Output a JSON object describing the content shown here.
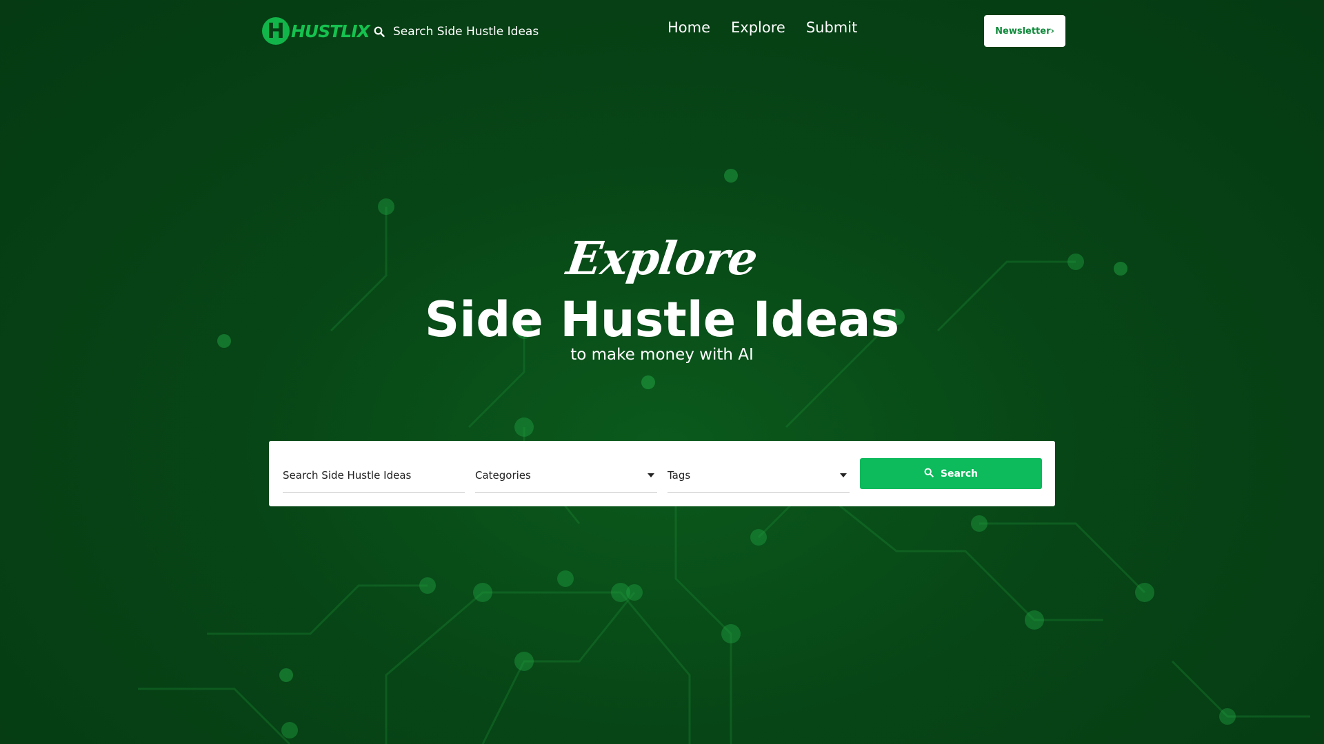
{
  "header": {
    "logo_mark": "H",
    "logo_text": "HUSTLIX",
    "search_text": "Search Side Hustle Ideas",
    "nav": [
      "Home",
      "Explore",
      "Submit"
    ],
    "newsletter_label": "Newsletter›"
  },
  "hero": {
    "script_title": "Explore",
    "title": "Side Hustle Ideas",
    "subtitle": "to make money with AI"
  },
  "search_panel": {
    "search_placeholder": "Search Side Hustle Ideas",
    "categories_label": "Categories",
    "tags_label": "Tags",
    "search_button": "Search"
  },
  "colors": {
    "background": "#074516",
    "brand_green": "#16c24f",
    "button_green": "#0dba5c"
  },
  "icons": [
    "search-icon",
    "caret-down-icon"
  ]
}
